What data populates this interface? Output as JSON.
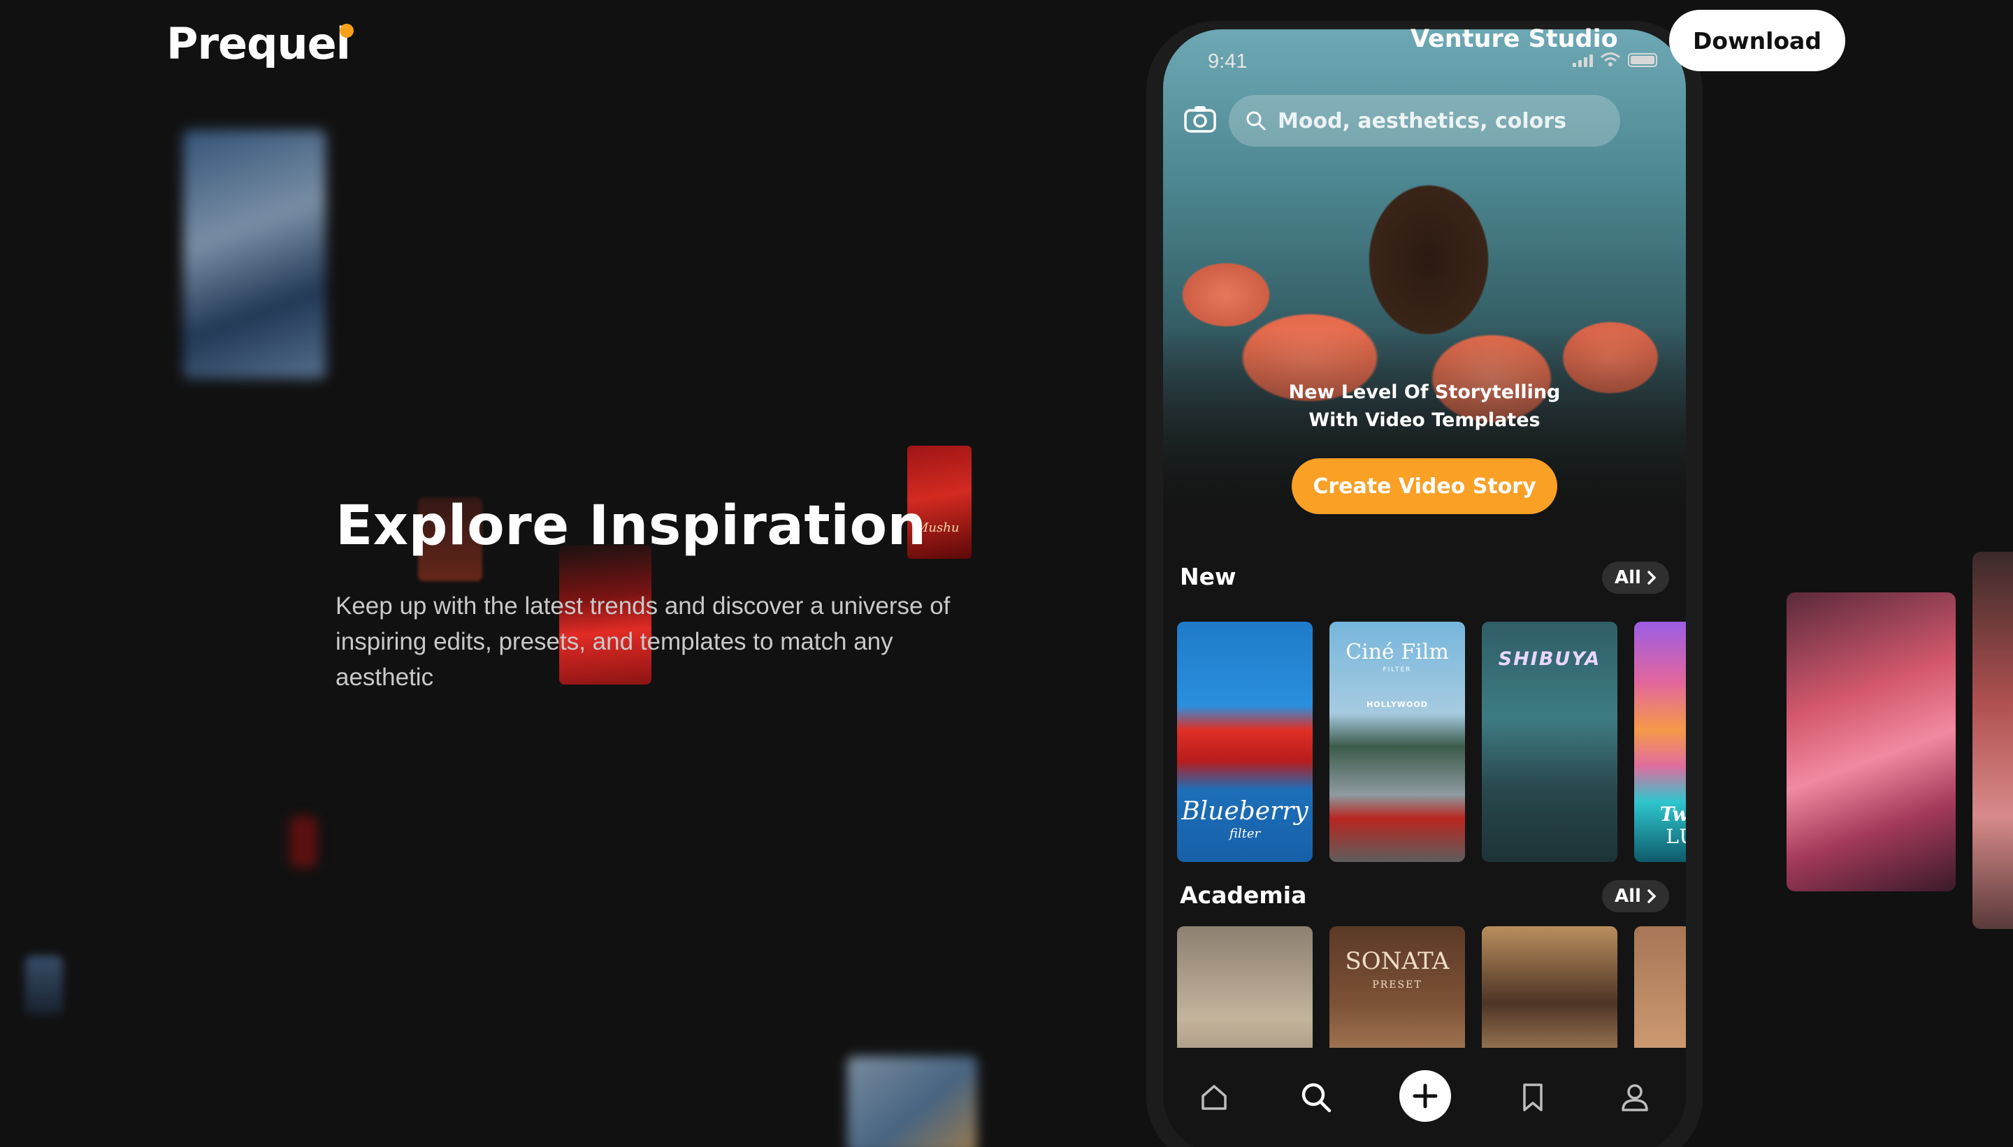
{
  "header": {
    "logo": "Prequel",
    "studio_label": "Venture Studio",
    "download_label": "Download"
  },
  "hero": {
    "title": "Explore Inspiration",
    "description": "Keep up with the latest trends and discover a universe of inspiring edits, presets, and templates to match any aesthetic"
  },
  "phone": {
    "status_time": "9:41",
    "search_placeholder": "Mood, aesthetics, colors",
    "promo": {
      "line1": "New Level Of Storytelling",
      "line2": "With Video Templates",
      "button": "Create Video Story"
    },
    "sections": [
      {
        "title": "New",
        "all_label": "All",
        "cards": [
          "Blueberry",
          "Ciné Film",
          "SHIBUYA",
          "Twinkle"
        ]
      },
      {
        "title": "Academia",
        "all_label": "All",
        "cards": [
          "",
          "SONATA",
          "",
          ""
        ]
      }
    ],
    "cards_detail": {
      "blueberry_sub": "filter",
      "cine_sub": "FILTER",
      "hollywood_sign": "HOLLYWOOD",
      "twinkle_sub": "LUSID",
      "sonata_sub": "PRESET"
    },
    "nav_icons": [
      "home-icon",
      "search-icon",
      "plus-icon",
      "bookmark-icon",
      "profile-icon"
    ]
  },
  "floating": {
    "mushu_label": "Mushu"
  },
  "colors": {
    "accent_orange": "#f9a025",
    "logo_dot": "#f7a21a",
    "background": "#111111"
  }
}
